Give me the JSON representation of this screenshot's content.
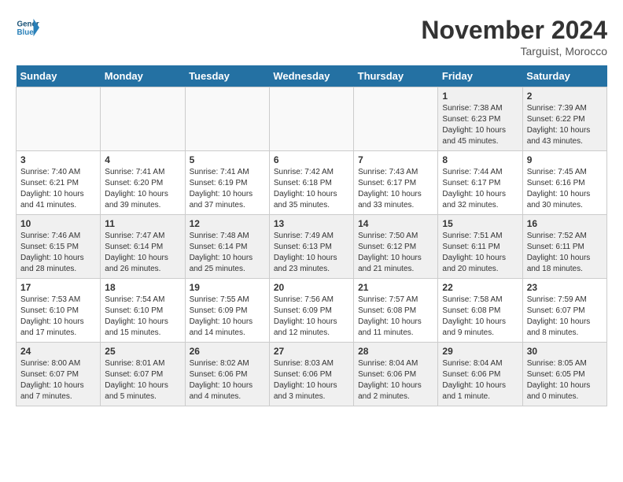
{
  "header": {
    "logo_line1": "General",
    "logo_line2": "Blue",
    "month": "November 2024",
    "location": "Targuist, Morocco"
  },
  "weekdays": [
    "Sunday",
    "Monday",
    "Tuesday",
    "Wednesday",
    "Thursday",
    "Friday",
    "Saturday"
  ],
  "weeks": [
    [
      {
        "num": "",
        "info": ""
      },
      {
        "num": "",
        "info": ""
      },
      {
        "num": "",
        "info": ""
      },
      {
        "num": "",
        "info": ""
      },
      {
        "num": "",
        "info": ""
      },
      {
        "num": "1",
        "info": "Sunrise: 7:38 AM\nSunset: 6:23 PM\nDaylight: 10 hours\nand 45 minutes."
      },
      {
        "num": "2",
        "info": "Sunrise: 7:39 AM\nSunset: 6:22 PM\nDaylight: 10 hours\nand 43 minutes."
      }
    ],
    [
      {
        "num": "3",
        "info": "Sunrise: 7:40 AM\nSunset: 6:21 PM\nDaylight: 10 hours\nand 41 minutes."
      },
      {
        "num": "4",
        "info": "Sunrise: 7:41 AM\nSunset: 6:20 PM\nDaylight: 10 hours\nand 39 minutes."
      },
      {
        "num": "5",
        "info": "Sunrise: 7:41 AM\nSunset: 6:19 PM\nDaylight: 10 hours\nand 37 minutes."
      },
      {
        "num": "6",
        "info": "Sunrise: 7:42 AM\nSunset: 6:18 PM\nDaylight: 10 hours\nand 35 minutes."
      },
      {
        "num": "7",
        "info": "Sunrise: 7:43 AM\nSunset: 6:17 PM\nDaylight: 10 hours\nand 33 minutes."
      },
      {
        "num": "8",
        "info": "Sunrise: 7:44 AM\nSunset: 6:17 PM\nDaylight: 10 hours\nand 32 minutes."
      },
      {
        "num": "9",
        "info": "Sunrise: 7:45 AM\nSunset: 6:16 PM\nDaylight: 10 hours\nand 30 minutes."
      }
    ],
    [
      {
        "num": "10",
        "info": "Sunrise: 7:46 AM\nSunset: 6:15 PM\nDaylight: 10 hours\nand 28 minutes."
      },
      {
        "num": "11",
        "info": "Sunrise: 7:47 AM\nSunset: 6:14 PM\nDaylight: 10 hours\nand 26 minutes."
      },
      {
        "num": "12",
        "info": "Sunrise: 7:48 AM\nSunset: 6:14 PM\nDaylight: 10 hours\nand 25 minutes."
      },
      {
        "num": "13",
        "info": "Sunrise: 7:49 AM\nSunset: 6:13 PM\nDaylight: 10 hours\nand 23 minutes."
      },
      {
        "num": "14",
        "info": "Sunrise: 7:50 AM\nSunset: 6:12 PM\nDaylight: 10 hours\nand 21 minutes."
      },
      {
        "num": "15",
        "info": "Sunrise: 7:51 AM\nSunset: 6:11 PM\nDaylight: 10 hours\nand 20 minutes."
      },
      {
        "num": "16",
        "info": "Sunrise: 7:52 AM\nSunset: 6:11 PM\nDaylight: 10 hours\nand 18 minutes."
      }
    ],
    [
      {
        "num": "17",
        "info": "Sunrise: 7:53 AM\nSunset: 6:10 PM\nDaylight: 10 hours\nand 17 minutes."
      },
      {
        "num": "18",
        "info": "Sunrise: 7:54 AM\nSunset: 6:10 PM\nDaylight: 10 hours\nand 15 minutes."
      },
      {
        "num": "19",
        "info": "Sunrise: 7:55 AM\nSunset: 6:09 PM\nDaylight: 10 hours\nand 14 minutes."
      },
      {
        "num": "20",
        "info": "Sunrise: 7:56 AM\nSunset: 6:09 PM\nDaylight: 10 hours\nand 12 minutes."
      },
      {
        "num": "21",
        "info": "Sunrise: 7:57 AM\nSunset: 6:08 PM\nDaylight: 10 hours\nand 11 minutes."
      },
      {
        "num": "22",
        "info": "Sunrise: 7:58 AM\nSunset: 6:08 PM\nDaylight: 10 hours\nand 9 minutes."
      },
      {
        "num": "23",
        "info": "Sunrise: 7:59 AM\nSunset: 6:07 PM\nDaylight: 10 hours\nand 8 minutes."
      }
    ],
    [
      {
        "num": "24",
        "info": "Sunrise: 8:00 AM\nSunset: 6:07 PM\nDaylight: 10 hours\nand 7 minutes."
      },
      {
        "num": "25",
        "info": "Sunrise: 8:01 AM\nSunset: 6:07 PM\nDaylight: 10 hours\nand 5 minutes."
      },
      {
        "num": "26",
        "info": "Sunrise: 8:02 AM\nSunset: 6:06 PM\nDaylight: 10 hours\nand 4 minutes."
      },
      {
        "num": "27",
        "info": "Sunrise: 8:03 AM\nSunset: 6:06 PM\nDaylight: 10 hours\nand 3 minutes."
      },
      {
        "num": "28",
        "info": "Sunrise: 8:04 AM\nSunset: 6:06 PM\nDaylight: 10 hours\nand 2 minutes."
      },
      {
        "num": "29",
        "info": "Sunrise: 8:04 AM\nSunset: 6:06 PM\nDaylight: 10 hours\nand 1 minute."
      },
      {
        "num": "30",
        "info": "Sunrise: 8:05 AM\nSunset: 6:05 PM\nDaylight: 10 hours\nand 0 minutes."
      }
    ]
  ]
}
